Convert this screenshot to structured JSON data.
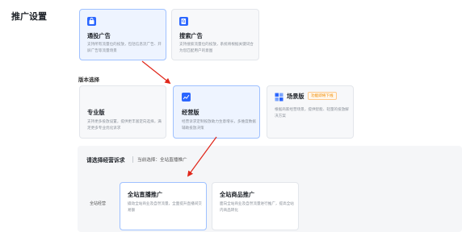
{
  "page_title": "推广设置",
  "version_label": "版本选择",
  "colors": {
    "accent": "#2b66ff",
    "arrow": "#e0261a",
    "tag": "#f08c00"
  },
  "promo_types": [
    {
      "title": "通投广告",
      "desc": "支持所有流量位的投放，包括信息流广告、开屏广告等流量场景",
      "icon": "bag-icon"
    },
    {
      "title": "搜索广告",
      "desc": "支持搜索流量位的投放，系统将根据关键词合为您匹配用户的意图",
      "icon": "search-doc-icon"
    }
  ],
  "versions": [
    {
      "title": "专业版",
      "desc": "支持更多投放设置，提供更丰富定向选择，满足更多专业优化诉求"
    },
    {
      "title": "经营版",
      "desc": "经营诉求定制投放助力生意增长，多维度数据辅助投放决策",
      "icon": "chart-icon"
    },
    {
      "title": "场景版",
      "tag": "功能即将下线",
      "desc": "根据商家经营场景，提供智能、轻量的投放解决方案",
      "icon": "grid-icon"
    }
  ],
  "panel": {
    "heading": "请选择经营诉求",
    "current": "当前选择：全站直播推广",
    "row_label": "全站经营",
    "options": [
      {
        "title": "全站直播推广",
        "desc": "撬动全站商业及自然流量，全面提升直播间交易额"
      },
      {
        "title": "全站商品推广",
        "desc": "面向全站商业及自然流量进行推广，提高全站内商品转化"
      }
    ]
  }
}
